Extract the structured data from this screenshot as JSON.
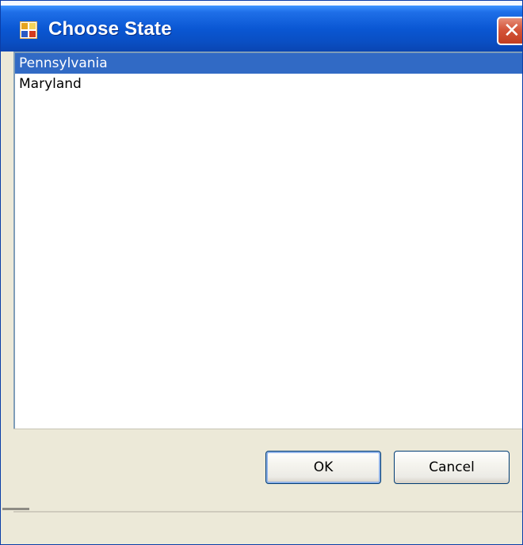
{
  "window": {
    "title": "Choose State",
    "close_symbol": "✕"
  },
  "icons": {
    "app": "application-window-icon",
    "close": "close-icon"
  },
  "list": {
    "selected_index": 0,
    "items": [
      {
        "label": "Pennsylvania"
      },
      {
        "label": "Maryland"
      }
    ]
  },
  "buttons": {
    "ok_label": "OK",
    "cancel_label": "Cancel"
  },
  "colors": {
    "titlebar": "#0a57d3",
    "selection": "#316ac5",
    "close_button": "#c33d20",
    "dialog_face": "#ece9d8"
  }
}
